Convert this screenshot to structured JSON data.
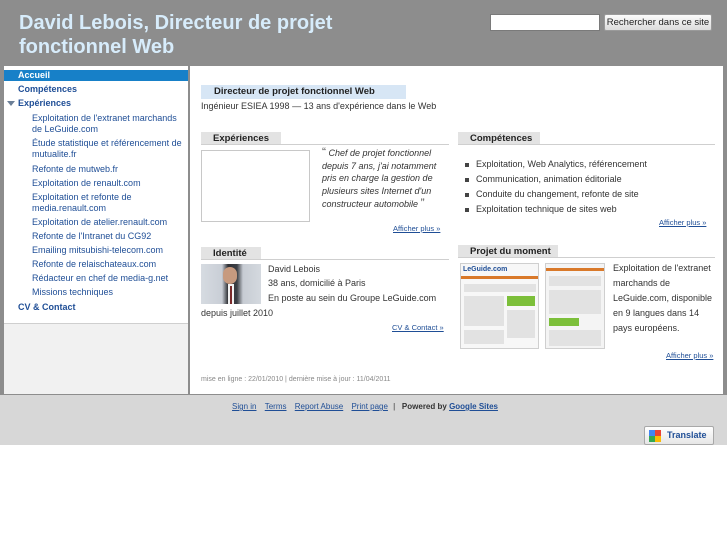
{
  "header": {
    "title": "David Lebois, Directeur de projet fonctionnel Web",
    "search_placeholder": "",
    "search_button": "Rechercher dans ce site"
  },
  "nav": {
    "home": "Accueil",
    "competences": "Compétences",
    "experiences": "Expériences",
    "sub_items": [
      "Exploitation de l'extranet marchands de LeGuide.com",
      "Étude statistique et référencement de mutualite.fr",
      "Refonte de mutweb.fr",
      "Exploitation de renault.com",
      "Exploitation et refonte de media.renault.com",
      "Exploitation de atelier.renault.com",
      "Refonte de l'Intranet du CG92",
      "Emailing mitsubishi-telecom.com",
      "Refonte de relaischateaux.com",
      "Rédacteur en chef de media-g.net",
      "Missions techniques"
    ],
    "cv_contact": "CV & Contact"
  },
  "main": {
    "headline": "Directeur de projet fonctionnel Web",
    "subline": "Ingénieur ESIEA 1998 — 13 ans d'expérience dans le Web",
    "experiences": {
      "title": "Expériences",
      "quote": "Chef de projet fonctionnel depuis 7 ans, j'ai notamment pris en charge la gestion de plusieurs sites Internet d'un constructeur automobile",
      "link": "Afficher plus »"
    },
    "competences": {
      "title": "Compétences",
      "items": [
        "Exploitation, Web Analytics, référencement",
        "Communication, animation éditoriale",
        "Conduite du changement, refonte de site",
        "Exploitation technique de sites web"
      ],
      "link": "Afficher plus »"
    },
    "identite": {
      "title": "Identité",
      "name": "David Lebois",
      "age": "38 ans, domicilié à Paris",
      "position": "En poste au sein du Groupe LeGuide.com",
      "since": "depuis juillet 2010",
      "link": "CV & Contact »"
    },
    "projet": {
      "title": "Projet du moment",
      "description": "Exploitation de l'extranet marchands de LeGuide.com, disponible en 9 langues dans 14 pays européens.",
      "link": "Afficher plus »",
      "shot_logo": "LeGuide.com"
    },
    "meta": "mise en ligne : 22/01/2010 | dernière mise à jour : 11/04/2011"
  },
  "footer": {
    "links": [
      "Sign in",
      "Terms",
      "Report Abuse",
      "Print page"
    ],
    "separator": "|",
    "powered_by": "Powered by",
    "google_sites": "Google Sites",
    "translate": "Translate"
  },
  "colors": {
    "header_bg": "#8d8d8d",
    "title": "#d7ecfb",
    "nav_active": "#1780c8",
    "link": "#1f4e96"
  }
}
